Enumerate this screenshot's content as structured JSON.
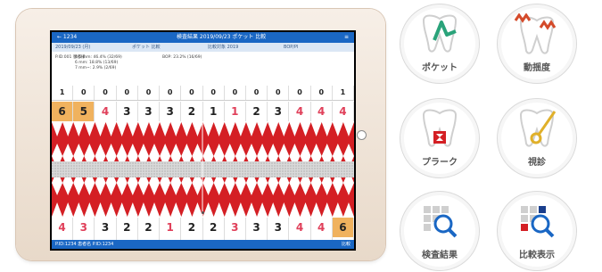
{
  "tablet_screen": {
    "topbar": {
      "left": "← 1234",
      "center": "検査結果 2019/09/23 ポケット 比較",
      "right": "≡"
    },
    "subbar": {
      "a": "2019/09/23 (月)",
      "b": "ポケット 比較",
      "c": "比較対象 2019",
      "d": "BOP/PI"
    },
    "info": [
      "P.ID:001 患者様",
      "4-5 mm: 46.4% (32/69)",
      "6 mm: 18.8% (13/69)",
      "7 mm~: 2.9% (2/69)",
      "BOP: 23.2% (16/69)"
    ],
    "row_top_small": [
      "1",
      "0",
      "0",
      "0",
      "0",
      "0",
      "0",
      "0",
      "0",
      "0",
      "0",
      "0",
      "0",
      "1"
    ],
    "row_top_big": [
      "6",
      "5",
      "4",
      "3",
      "3",
      "3",
      "2",
      "1",
      "1",
      "2",
      "3",
      "4",
      "4",
      "4"
    ],
    "row_top_big_red": [
      false,
      false,
      true,
      false,
      false,
      false,
      false,
      false,
      true,
      false,
      false,
      true,
      true,
      true
    ],
    "row_top_big_highlight": [
      true,
      true,
      false,
      false,
      false,
      false,
      false,
      false,
      false,
      false,
      false,
      false,
      false,
      false
    ],
    "row_bot_big": [
      "4",
      "3",
      "3",
      "2",
      "2",
      "1",
      "2",
      "2",
      "3",
      "3",
      "3",
      "4",
      "4",
      "6"
    ],
    "row_bot_big_red": [
      true,
      true,
      false,
      false,
      false,
      true,
      false,
      false,
      true,
      false,
      false,
      true,
      true,
      false
    ],
    "row_bot_big_highlight": [
      false,
      false,
      false,
      false,
      false,
      false,
      false,
      false,
      false,
      false,
      false,
      false,
      false,
      true
    ],
    "row_bot_small": [
      "1",
      "0",
      "0",
      "0",
      "0",
      "0",
      "0",
      "0",
      "0",
      "0",
      "0",
      "0",
      "0",
      "1"
    ],
    "bottombar": {
      "left": "P.ID:1234 患者名 P.ID:1234",
      "right": "比較"
    }
  },
  "menu": [
    {
      "label": "ポケット",
      "icon": "pocket-tooth-icon"
    },
    {
      "label": "動揺度",
      "icon": "mobility-tooth-icon"
    },
    {
      "label": "プラーク",
      "icon": "plaque-tooth-icon"
    },
    {
      "label": "視診",
      "icon": "inspection-tooth-icon"
    },
    {
      "label": "検査結果",
      "icon": "results-search-icon"
    },
    {
      "label": "比較表示",
      "icon": "compare-search-icon"
    }
  ],
  "colors": {
    "accent_blue": "#1a67c4",
    "teeth_red": "#d41f24",
    "highlight_orange": "#f0b25e",
    "icon_green": "#2aa37a",
    "icon_red": "#d44a2a",
    "icon_gold": "#e0b02a"
  }
}
